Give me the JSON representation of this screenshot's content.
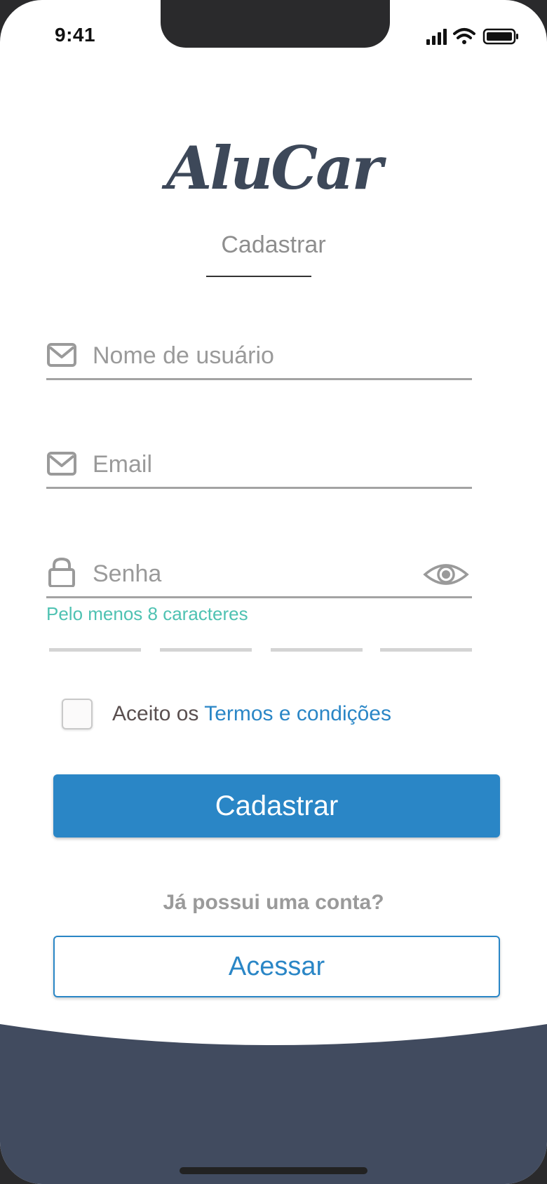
{
  "status_bar": {
    "time": "9:41",
    "icons": [
      "signal-icon",
      "wifi-icon",
      "battery-icon"
    ]
  },
  "app": {
    "logo": "AluCar"
  },
  "tab": {
    "label": "Cadastrar"
  },
  "form": {
    "username": {
      "placeholder": "Nome de usuário",
      "icon": "mail-icon"
    },
    "email": {
      "placeholder": "Email",
      "icon": "mail-icon"
    },
    "password": {
      "placeholder": "Senha",
      "icon": "lock-icon",
      "toggle_icon": "eye-icon",
      "hint": "Pelo menos 8 caracteres",
      "strength_segments_filled": 0,
      "strength_segments_total": 4
    },
    "terms": {
      "prefix": "Aceito os ",
      "link": "Termos e condições",
      "checked": false
    },
    "submit_label": "Cadastrar"
  },
  "login": {
    "question": "Já possui uma conta?",
    "button_label": "Acessar"
  },
  "colors": {
    "primary": "#2a86c6",
    "hint": "#4fc2b2",
    "logo": "#3d4859",
    "footer": "#414b5f"
  }
}
